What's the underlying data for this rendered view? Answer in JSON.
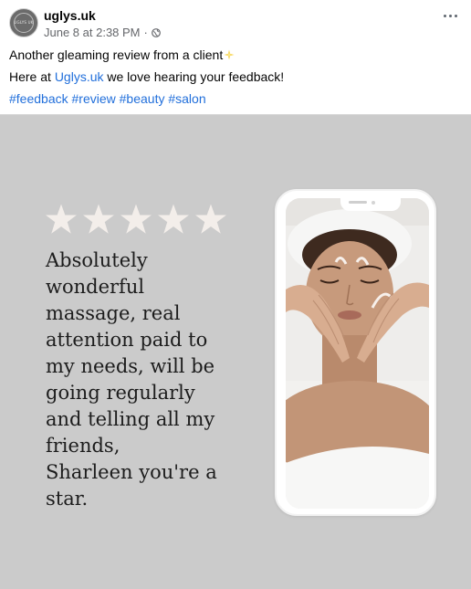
{
  "post": {
    "page_name": "uglys.uk",
    "date": "June 8 at 2:38 PM",
    "separator": "·",
    "privacy_icon": "globe-icon",
    "more_icon": "more-horizontal-icon",
    "avatar_text": "UGLYS UK"
  },
  "caption": {
    "line1": "Another gleaming review from a client",
    "line1_emoji": "sparkle-icon",
    "line2_prefix": "Here at ",
    "line2_link": "Uglys.uk",
    "line2_suffix": " we love hearing your feedback!",
    "hashtags": [
      "#feedback",
      "#review",
      "#beauty",
      "#salon"
    ]
  },
  "image": {
    "background_color": "#cbcbcb",
    "rating": {
      "value": 5,
      "max": 5,
      "star_color": "#f3eeea"
    },
    "review_lines": [
      "Absolutely",
      "wonderful",
      "massage, real",
      "attention paid to",
      "my needs, will be",
      "going regularly",
      "and telling all my",
      "friends,",
      "Sharleen you're a",
      "star."
    ],
    "phone_photo": "woman-receiving-facial-massage-photo"
  },
  "colors": {
    "link": "#216fdb",
    "secondary_text": "#65676b",
    "primary_text": "#050505"
  }
}
